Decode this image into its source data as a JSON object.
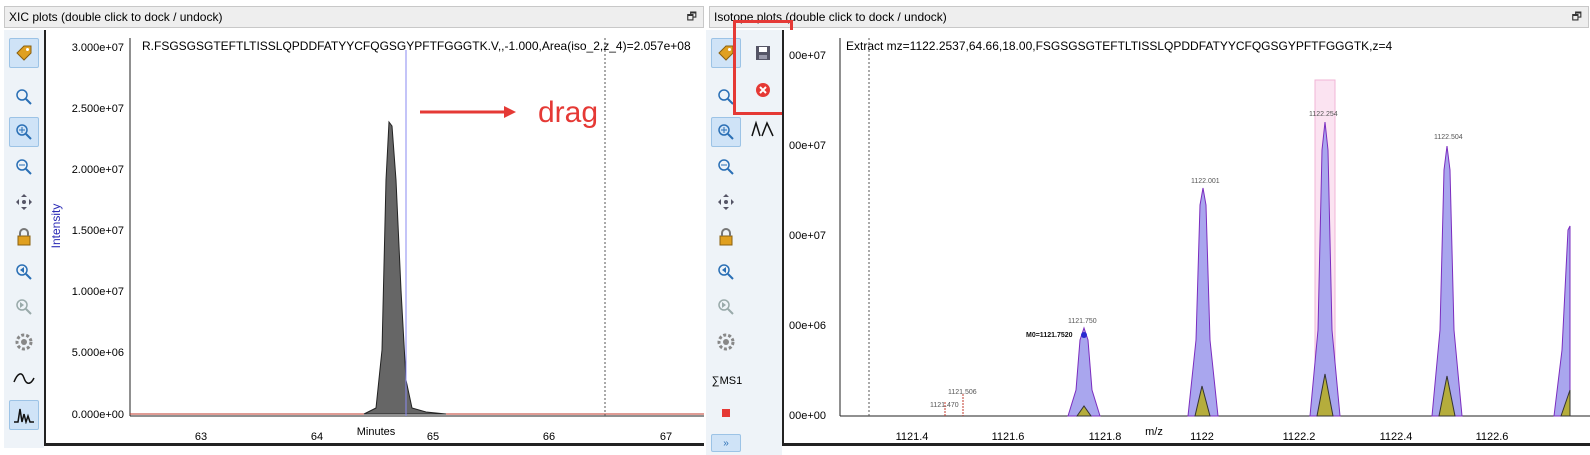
{
  "left_panel": {
    "title": "XIC plots (double click to dock / undock)",
    "plot_title": "R.FSGSGSGTEFTLTISSLQPDDFATYYCFQGSGYPFTFGGGTK.V,,-1.000,Area(iso_2,z_4)=2.057e+08",
    "y_ticks": [
      "3.000e+07",
      "2.500e+07",
      "2.000e+07",
      "1.500e+07",
      "1.000e+07",
      "5.000e+06",
      "0.000e+00"
    ],
    "x_ticks": [
      "63",
      "64",
      "65",
      "66",
      "67"
    ],
    "y_label": "Intensity",
    "x_label": "Minutes",
    "annotation": "drag"
  },
  "right_panel": {
    "title": "Isotope plots (double click to dock / undock)",
    "plot_title": "Extract mz=1122.2537,64.66,18.00,FSGSGSGTEFTLTISSLQPDDFATYYCFQGSGYPFTFGGGTK,z=4",
    "y_ticks": [
      "00e+07",
      "00e+07",
      "00e+07",
      "00e+06",
      "00e+00"
    ],
    "x_ticks": [
      "1121.4",
      "1121.6",
      "1121.8",
      "1122",
      "1122.2",
      "1122.4",
      "1122.6"
    ],
    "x_label": "m/z",
    "peak_labels": [
      "1121.470",
      "1121.506",
      "1121.750",
      "1122.001",
      "1122.254",
      "1122.504"
    ],
    "m0_label": "M0=1121.7520",
    "sum_label": "∑MS1"
  },
  "undock_icon": "restore-icon",
  "colors": {
    "accent": "#e53935",
    "selection": "#9cc3e6",
    "peak_fill": "#a9a6ee",
    "iso_fill": "#b5ad3c"
  }
}
